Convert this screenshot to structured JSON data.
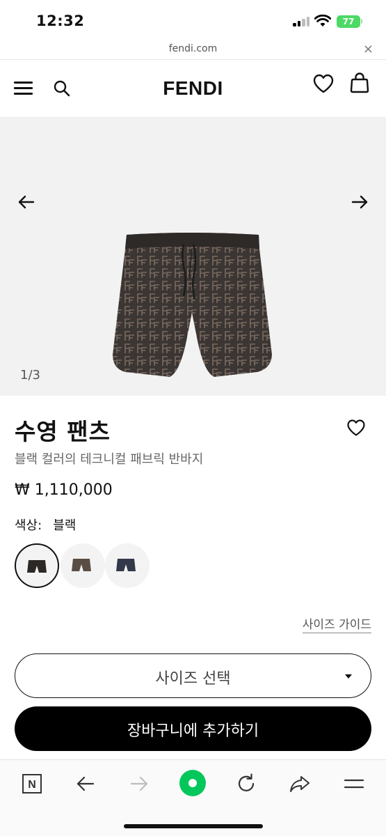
{
  "status_bar": {
    "time": "12:32",
    "battery": "77"
  },
  "browser": {
    "url": "fendi.com",
    "close_glyph": "×"
  },
  "header": {
    "brand": "FENDI",
    "icons": [
      "menu-icon",
      "search-icon",
      "heart-icon",
      "shopping-bag-icon"
    ]
  },
  "gallery": {
    "counter": "1/3"
  },
  "product": {
    "title": "수영 팬츠",
    "subtitle": "블랙 컬러의 테크니컬 패브릭 반바지",
    "price": "₩ 1,110,000",
    "color_label": "색상:",
    "color_value": "블랙",
    "swatch_colors": [
      "#2b2826",
      "#5a4e44",
      "#33394a"
    ]
  },
  "size_guide": "사이즈 가이드",
  "size_select": {
    "label": "사이즈 선택"
  },
  "add_to_cart": "장바구니에 추가하기",
  "toolbar": {
    "n_label": "N",
    "accent": "#03c75a"
  }
}
